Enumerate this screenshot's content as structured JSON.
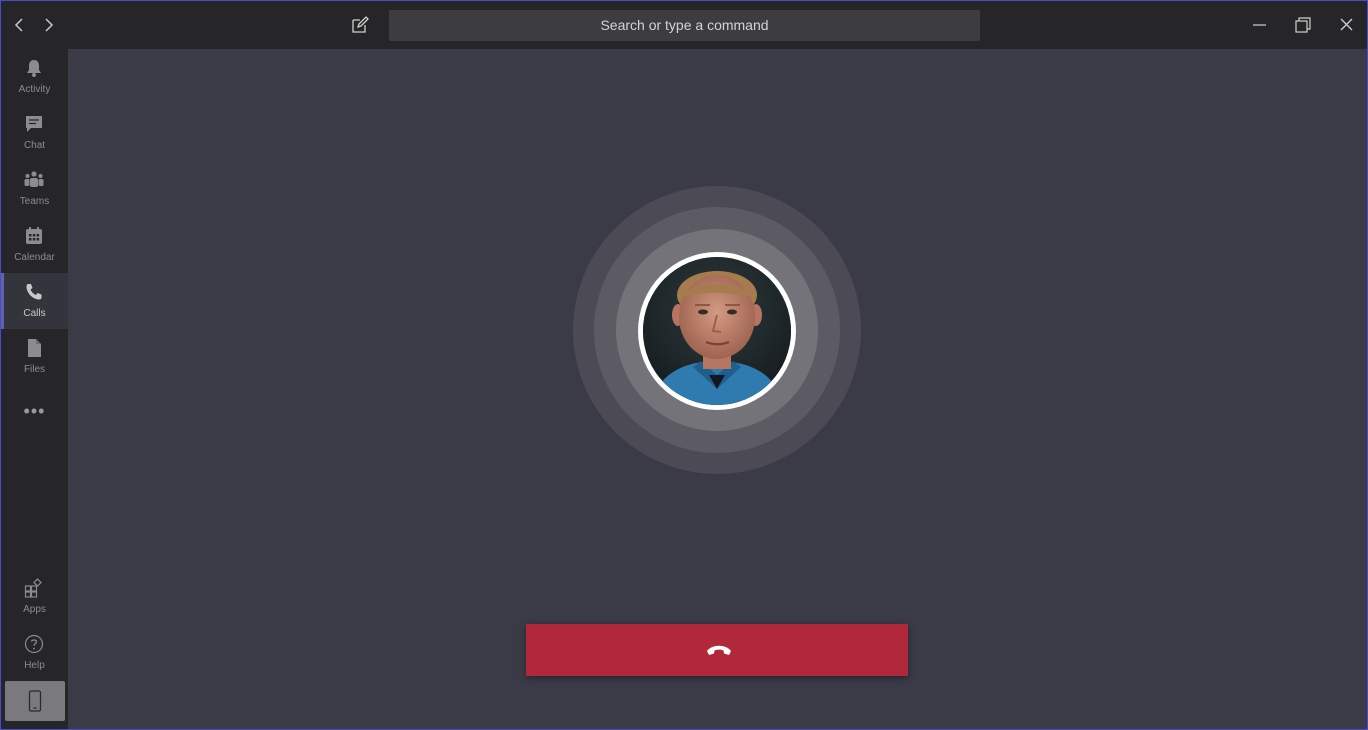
{
  "titlebar": {
    "search_placeholder": "Search or type a command",
    "icons": {
      "back": "chevron-left-icon",
      "forward": "chevron-right-icon",
      "compose": "compose-icon",
      "minimize": "minimize-icon",
      "restore": "restore-icon",
      "close": "close-icon"
    }
  },
  "rail": {
    "items": [
      {
        "label": "Activity",
        "icon": "bell-icon"
      },
      {
        "label": "Chat",
        "icon": "chat-icon"
      },
      {
        "label": "Teams",
        "icon": "teams-icon"
      },
      {
        "label": "Calendar",
        "icon": "calendar-icon"
      },
      {
        "label": "Calls",
        "icon": "phone-icon",
        "active": true
      },
      {
        "label": "Files",
        "icon": "file-icon"
      }
    ],
    "more": "•••",
    "bottom": [
      {
        "label": "Apps",
        "icon": "apps-icon"
      },
      {
        "label": "Help",
        "icon": "help-icon"
      }
    ],
    "device_icon": "mobile-device-icon"
  },
  "call": {
    "state": "ringing",
    "hangup_icon": "hang-up-icon"
  },
  "colors": {
    "accent": "#6264a7",
    "hangup": "#b0283a",
    "background": "#3b3a47",
    "chrome": "#262628"
  }
}
